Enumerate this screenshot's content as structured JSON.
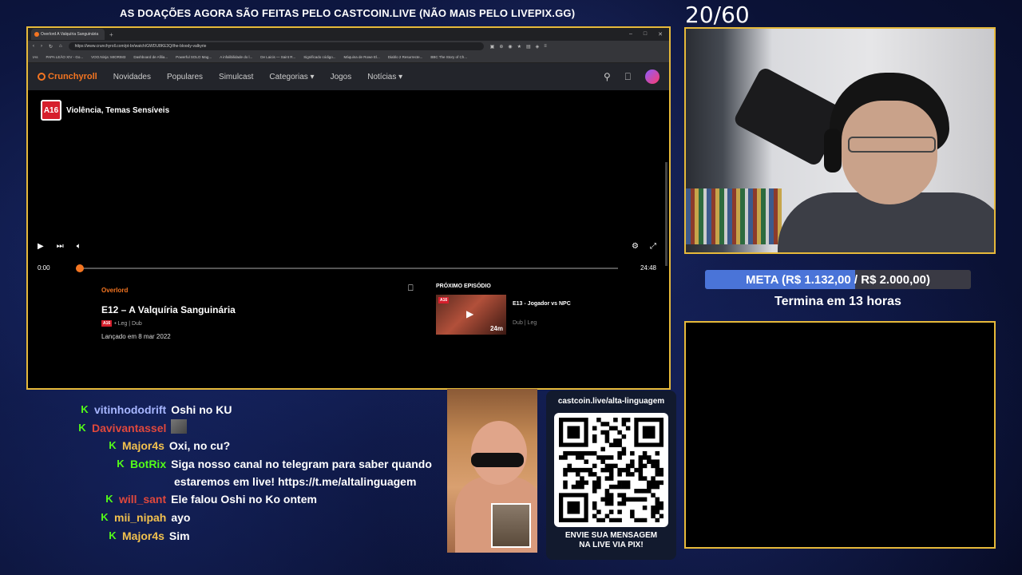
{
  "banner": "AS DOAÇÕES AGORA SÃO FEITAS PELO CASTCOIN.LIVE (NÃO MAIS PELO LIVEPIX.GG)",
  "counter": "20/60",
  "browser": {
    "tab_title": "Overlord A Valquíria Sanguinária",
    "url": "https://www.crunchyroll.com/pt-br/watch/GWDU8KE3Q/the-bloody-valkyrie",
    "bookmarks": [
      "IAs",
      "PAPA LEÃO XIV - Go...",
      "VOO.Ninja: MIORIM3",
      "Dashboard de Afilia...",
      "Powerful SOLO Mag...",
      "A infalibilidade do l...",
      "De Laicis — Saint R...",
      "Significado código...",
      "Máquina de Rowe El...",
      "Diablo 2 Resurrecte...",
      "BBC The Story of Ch..."
    ]
  },
  "crunchyroll": {
    "logo": "Crunchyroll",
    "nav": [
      "Novidades",
      "Populares",
      "Simulcast",
      "Categorias",
      "Jogos",
      "Notícias"
    ],
    "rating_badge": "A16",
    "rating_text": "Violência, Temas Sensíveis",
    "time_current": "0:00",
    "time_total": "24:48",
    "progress": 0.0,
    "series": "Overlord",
    "episode_title": "E12 – A Valquíria Sanguinária",
    "meta": "• Leg | Dub",
    "release": "Lançado em 8 mar 2022",
    "next_header": "PRÓXIMO EPISÓDIO",
    "next_title": "E13 - Jogador vs NPC",
    "next_meta": "Dub | Leg",
    "next_duration": "24m"
  },
  "donation": {
    "goal_text": "META (R$ 1.132,00 / R$ 2.000,00)",
    "goal_fraction": 0.566,
    "ends": "Termina em 13 horas"
  },
  "chat": [
    {
      "user": "vitinhododrift",
      "color": "#a7b6ff",
      "text": "Oshi no KU"
    },
    {
      "user": "Davivantassel",
      "color": "#e0483c",
      "text": ""
    },
    {
      "user": "Major4s",
      "color": "#f2c14e",
      "text": "Oxi, no cu?"
    },
    {
      "user": "BotRix",
      "color": "#53fc18",
      "text": "Siga nosso canal no telegram para saber quando"
    },
    {
      "user": "",
      "color": "#ffffff",
      "text": "estaremos em live! https://t.me/altalinguagem"
    },
    {
      "user": "will_sant",
      "color": "#e0483c",
      "text": "Ele falou Oshi no Ko ontem"
    },
    {
      "user": "mii_nipah",
      "color": "#f2c14e",
      "text": "ayo"
    },
    {
      "user": "Major4s",
      "color": "#f2c14e",
      "text": "Sim"
    }
  ],
  "qr": {
    "title": "castcoin.live/alta-linguagem",
    "line1": "ENVIE SUA MENSAGEM",
    "line2": "NA LIVE VIA PIX!"
  }
}
